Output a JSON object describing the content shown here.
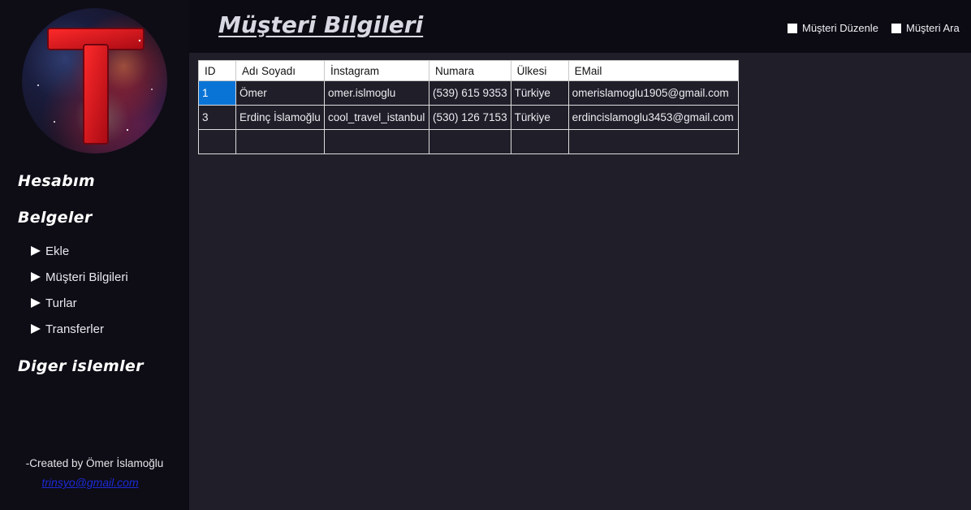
{
  "sidebar": {
    "sections": [
      {
        "label": "Hesabım"
      },
      {
        "label": "Belgeler"
      },
      {
        "label": "Diger islemler"
      }
    ],
    "items": [
      {
        "label": "Ekle"
      },
      {
        "label": "Müşteri Bilgileri"
      },
      {
        "label": "Turlar"
      },
      {
        "label": "Transferler"
      }
    ],
    "credit": "-Created by Ömer İslamoğlu",
    "email": "trinsyo@gmail.com"
  },
  "header": {
    "title": "Müşteri Bilgileri",
    "checkboxes": [
      {
        "label": "Müşteri Düzenle",
        "checked": false
      },
      {
        "label": "Müşteri Ara",
        "checked": false
      }
    ]
  },
  "table": {
    "columns": [
      "ID",
      "Adı Soyadı",
      "İnstagram",
      "Numara",
      "Ülkesi",
      "EMail"
    ],
    "rows": [
      [
        "1",
        "Ömer",
        "omer.islmoglu",
        "(539) 615 9353",
        "Türkiye",
        "omerislamoglu1905@gmail.com"
      ],
      [
        "3",
        "Erdinç İslamoğlu",
        "cool_travel_istanbul",
        "(530) 126 7153",
        "Türkiye",
        "erdincislamoglu3453@gmail.com"
      ],
      [
        "",
        "",
        "",
        "",
        "",
        ""
      ]
    ]
  },
  "colors": {
    "selection": "#0a74d6",
    "logo_letter": "#e0141e",
    "link": "#1c2bd8"
  }
}
